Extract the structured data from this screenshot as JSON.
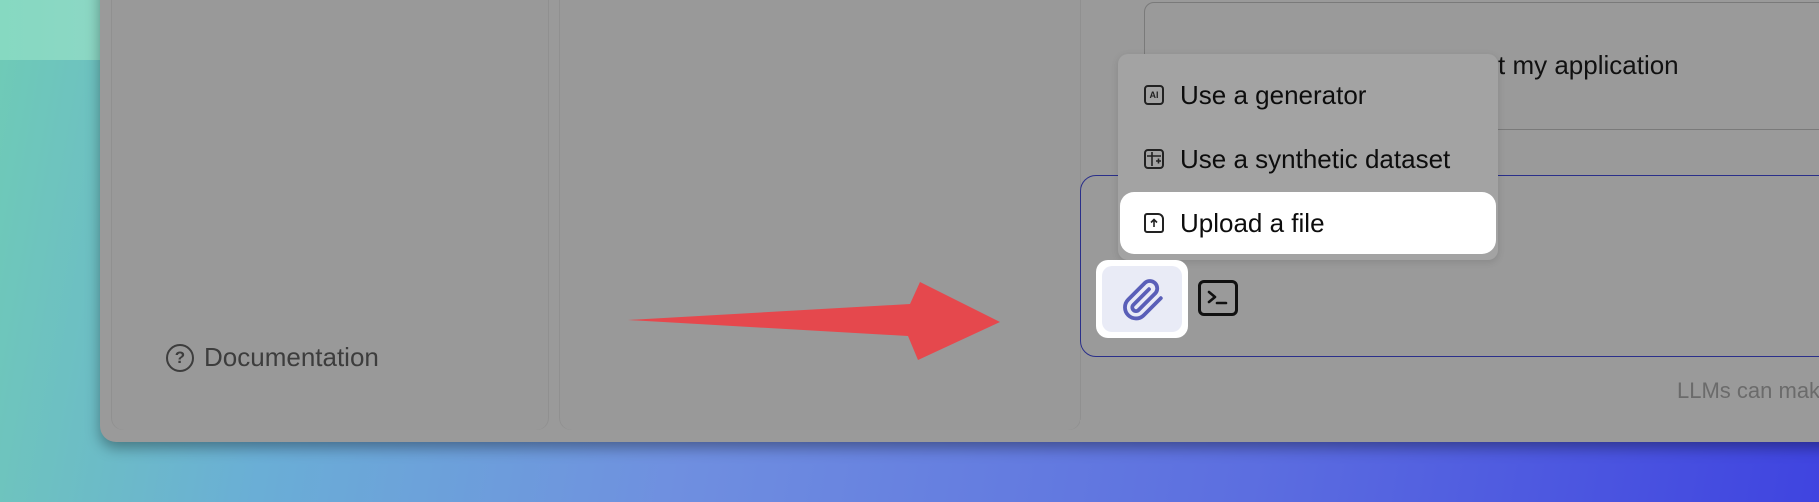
{
  "sidebar": {
    "documentation_label": "Documentation",
    "documentation_icon": "help-circle-icon"
  },
  "suggestion": {
    "visible_text": "st my application"
  },
  "attach_menu": {
    "items": [
      {
        "label": "Use a generator",
        "icon": "ai-chip-icon",
        "active": false
      },
      {
        "label": "Use a synthetic dataset",
        "icon": "table-plus-icon",
        "active": false
      },
      {
        "label": "Upload a file",
        "icon": "file-upload-icon",
        "active": true
      }
    ]
  },
  "composer": {
    "attach_icon": "paperclip-icon",
    "command_icon": "terminal-icon",
    "disclaimer": "LLMs can make mistak"
  },
  "annotation": {
    "arrow_color": "#e5484d"
  }
}
